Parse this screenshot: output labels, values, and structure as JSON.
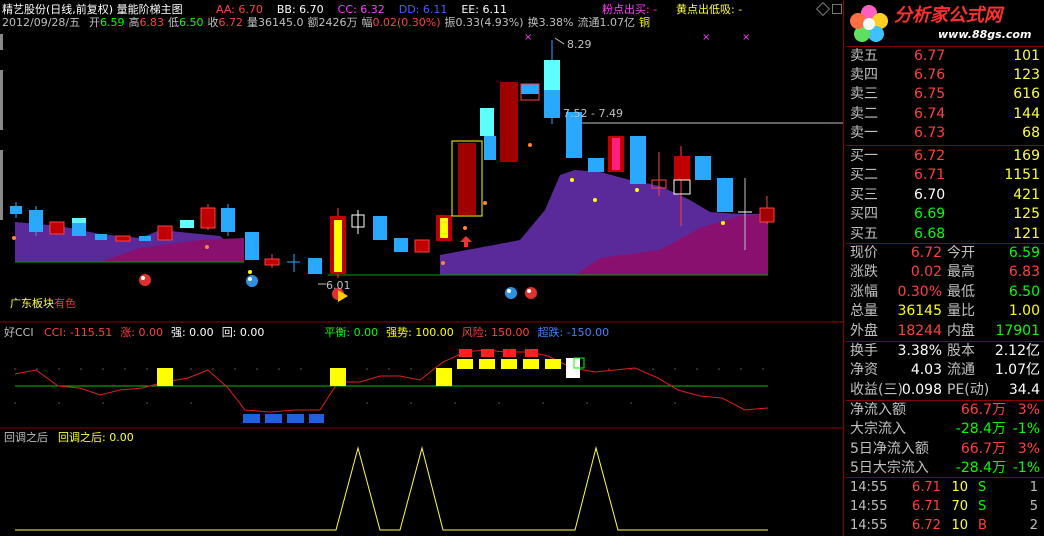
{
  "header": {
    "stock": "精艺股份(日线,前复权) 量能阶梯主图",
    "indicators": [
      {
        "label": "AA: 6.70",
        "color": "#ff4040"
      },
      {
        "label": "BB: 6.70",
        "color": "#ffffff"
      },
      {
        "label": "CC: 6.32",
        "color": "#ff40ff"
      },
      {
        "label": "DD: 6.11",
        "color": "#4060ff"
      },
      {
        "label": "EE: 6.11",
        "color": "#ffffff"
      }
    ],
    "signal1": "粉点出买: -",
    "signal2": "黄点出低吸: -",
    "date": "2012/09/28/五",
    "ohlc": [
      {
        "k": "开",
        "v": "6.59",
        "color": "#00ff00"
      },
      {
        "k": "高",
        "v": "6.83",
        "color": "#ff4040"
      },
      {
        "k": "低",
        "v": "6.50",
        "color": "#00ff00"
      },
      {
        "k": "收",
        "v": "6.72",
        "color": "#ff4040"
      },
      {
        "k": "量",
        "v": "36145.0",
        "color": "#c0c0c0"
      },
      {
        "k": "额",
        "v": "2426万",
        "color": "#c0c0c0"
      },
      {
        "k": "幅",
        "v": "0.02(0.30%)",
        "color": "#ff4040"
      },
      {
        "k": "振",
        "v": "0.33(4.93%)",
        "color": "#c0c0c0"
      },
      {
        "k": "换",
        "v": "3.38%",
        "color": "#c0c0c0"
      },
      {
        "k": "流通",
        "v": "1.07亿",
        "color": "#c0c0c0"
      },
      {
        "k": "",
        "v": "铜",
        "color": "#ffff00"
      }
    ]
  },
  "chart_annotations": {
    "high_label": "8.29",
    "mid_label": "7.52 - 7.49",
    "low_label": "6.01",
    "sector_label": "广东板块",
    "sector_value": "有色"
  },
  "cci_panel": {
    "name": "好CCI",
    "values": [
      {
        "label": "CCI: -115.51",
        "color": "#ff4040"
      },
      {
        "label": "涨: 0.00",
        "color": "#ff4040"
      },
      {
        "label": "强: 0.00",
        "color": "#ffffff"
      },
      {
        "label": "回: 0.00",
        "color": "#ffffff"
      },
      {
        "label": "平衡: 0.00",
        "color": "#00ff00"
      },
      {
        "label": "强势: 100.00",
        "color": "#ffff00"
      },
      {
        "label": "风险: 150.00",
        "color": "#ff4040"
      },
      {
        "label": "超跌: -150.00",
        "color": "#4080ff"
      }
    ]
  },
  "pullback_panel": {
    "name": "回调之后",
    "value_label": "回调之后: 0.00"
  },
  "quote": {
    "sells": [
      {
        "label": "卖五",
        "price": "6.77",
        "vol": "101"
      },
      {
        "label": "卖四",
        "price": "6.76",
        "vol": "123"
      },
      {
        "label": "卖三",
        "price": "6.75",
        "vol": "616"
      },
      {
        "label": "卖二",
        "price": "6.74",
        "vol": "144"
      },
      {
        "label": "卖一",
        "price": "6.73",
        "vol": "68"
      }
    ],
    "buys": [
      {
        "label": "买一",
        "price": "6.72",
        "vol": "169",
        "pc": "#ff4040"
      },
      {
        "label": "买二",
        "price": "6.71",
        "vol": "1151",
        "pc": "#ff4040"
      },
      {
        "label": "买三",
        "price": "6.70",
        "vol": "421",
        "pc": "#ffffff"
      },
      {
        "label": "买四",
        "price": "6.69",
        "vol": "125",
        "pc": "#00ff00"
      },
      {
        "label": "买五",
        "price": "6.68",
        "vol": "121",
        "pc": "#00ff00"
      }
    ],
    "stats": [
      {
        "l1": "现价",
        "v1": "6.72",
        "c1": "#ff4040",
        "l2": "今开",
        "v2": "6.59",
        "c2": "#00ff00"
      },
      {
        "l1": "涨跌",
        "v1": "0.02",
        "c1": "#ff4040",
        "l2": "最高",
        "v2": "6.83",
        "c2": "#ff4040"
      },
      {
        "l1": "涨幅",
        "v1": "0.30%",
        "c1": "#ff4040",
        "l2": "最低",
        "v2": "6.50",
        "c2": "#00ff00"
      },
      {
        "l1": "总量",
        "v1": "36145",
        "c1": "#ffff00",
        "l2": "量比",
        "v2": "1.00",
        "c2": "#ffff00"
      },
      {
        "l1": "外盘",
        "v1": "18244",
        "c1": "#ff4040",
        "l2": "内盘",
        "v2": "17901",
        "c2": "#00ff00"
      }
    ],
    "stats2": [
      {
        "l1": "换手",
        "v1": "3.38%",
        "l2": "股本",
        "v2": "2.12亿"
      },
      {
        "l1": "净资",
        "v1": "4.03",
        "l2": "流通",
        "v2": "1.07亿"
      },
      {
        "l1": "收益(三)",
        "v1": "0.098",
        "l2": "PE(动)",
        "v2": "34.4"
      }
    ],
    "flows": [
      {
        "label": "净流入额",
        "v": "66.7万",
        "p": "3%",
        "c": "#ff4040"
      },
      {
        "label": "大宗流入",
        "v": "-28.4万",
        "p": "-1%",
        "c": "#00ff00"
      },
      {
        "label": "5日净流入额",
        "v": "66.7万",
        "p": "3%",
        "c": "#ff4040"
      },
      {
        "label": "5日大宗流入",
        "v": "-28.4万",
        "p": "-1%",
        "c": "#00ff00"
      }
    ],
    "ticks": [
      {
        "time": "14:55",
        "price": "6.71",
        "vol": "10",
        "side": "S",
        "n": "1",
        "pc": "#ff4040",
        "sc": "#00ff00"
      },
      {
        "time": "14:55",
        "price": "6.71",
        "vol": "70",
        "side": "S",
        "n": "5",
        "pc": "#ff4040",
        "sc": "#00ff00"
      },
      {
        "time": "14:55",
        "price": "6.72",
        "vol": "10",
        "side": "B",
        "n": "2",
        "pc": "#ff4040",
        "sc": "#ff4040"
      }
    ]
  },
  "watermark": {
    "name": "分析家公式网",
    "url": "www.88gs.com"
  }
}
